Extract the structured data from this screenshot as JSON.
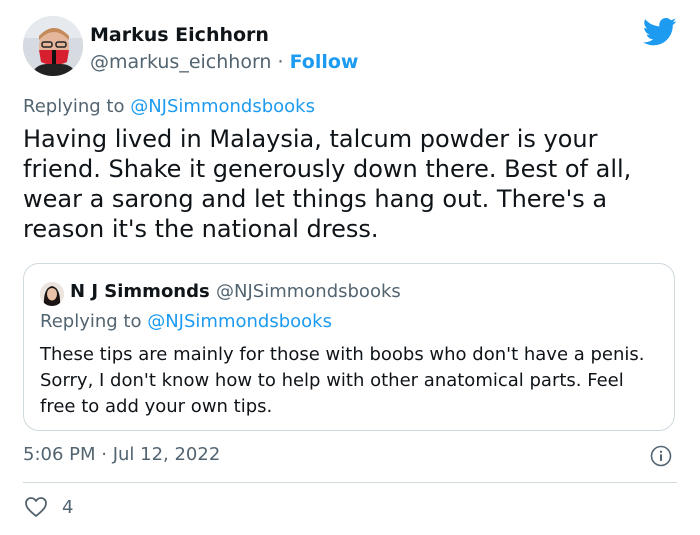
{
  "tweet": {
    "author_name": "Markus Eichhorn",
    "author_handle": "@markus_eichhorn",
    "separator": " · ",
    "follow_label": "Follow",
    "replying_prefix": "Replying to ",
    "replying_to": "@NJSimmondsbooks",
    "text": "Having lived in Malaysia, talcum powder is your friend. Shake it generously down there. Best of all, wear a sarong and let things hang out. There's a reason it's the national dress.",
    "timestamp": "5:06 PM · Jul 12, 2022",
    "like_count": "4"
  },
  "quoted": {
    "author_name": "N J Simmonds",
    "author_handle": "@NJSimmondsbooks",
    "replying_prefix": "Replying to ",
    "replying_to": "@NJSimmondsbooks",
    "text": "These tips are mainly for those with boobs who don't have a penis. Sorry, I don't know how to help with other anatomical parts. Feel free to add your own tips."
  },
  "icons": {
    "brand": "twitter-bird-icon",
    "info": "info-icon",
    "like": "heart-icon"
  },
  "colors": {
    "accent": "#1d9bf0",
    "secondary_text": "#536471",
    "border": "#cfd9de"
  }
}
